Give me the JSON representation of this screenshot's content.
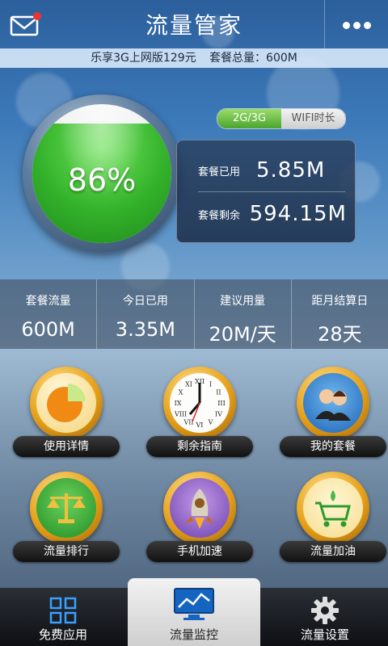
{
  "header": {
    "title": "流量管家",
    "mail_icon": "mail-icon",
    "more_icon": "more-dots-icon"
  },
  "plan_strip": {
    "plan_name": "乐享3G上网版129元",
    "total_label": "套餐总量：600M"
  },
  "gauge": {
    "percent_text": "86%",
    "fill_fraction": 0.86
  },
  "mode_tabs": [
    {
      "label": "2G/3G",
      "active": true
    },
    {
      "label": "WIFI时长",
      "active": false
    }
  ],
  "usage": {
    "used_label": "套餐已用",
    "used_value": "5.85M",
    "remaining_label": "套餐剩余",
    "remaining_value": "594.15M"
  },
  "stats": [
    {
      "label": "套餐流量",
      "value": "600M"
    },
    {
      "label": "今日已用",
      "value": "3.35M"
    },
    {
      "label": "建议用量",
      "value": "20M/天"
    },
    {
      "label": "距月结算日",
      "value": "28天"
    }
  ],
  "tiles": [
    {
      "label": "使用详情",
      "icon": "pie-chart-icon"
    },
    {
      "label": "剩余指南",
      "icon": "clock-icon"
    },
    {
      "label": "我的套餐",
      "icon": "users-icon"
    },
    {
      "label": "流量排行",
      "icon": "scales-icon"
    },
    {
      "label": "手机加速",
      "icon": "rocket-icon"
    },
    {
      "label": "流量加油",
      "icon": "cart-icon"
    }
  ],
  "clock_numerals": [
    "XII",
    "I",
    "II",
    "III",
    "IV",
    "V",
    "VI",
    "VII",
    "VIII",
    "IX",
    "X",
    "XI"
  ],
  "tab_bar": [
    {
      "label": "免费应用",
      "icon": "apps-grid-icon",
      "active": false
    },
    {
      "label": "流量监控",
      "icon": "monitor-chart-icon",
      "active": true
    },
    {
      "label": "流量设置",
      "icon": "gear-icon",
      "active": false
    }
  ],
  "colors": {
    "accent_green": "#3fbf2e",
    "tile_gold": "#e6a019"
  }
}
